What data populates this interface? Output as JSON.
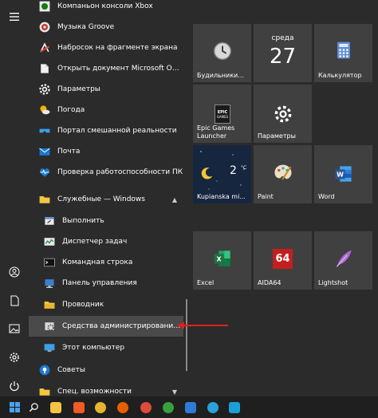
{
  "apps": [
    {
      "label": "Компаньон консоли Xbox",
      "icon": "xbox-icon"
    },
    {
      "label": "Музыка Groove",
      "icon": "groove-icon"
    },
    {
      "label": "Набросок на фрагменте экрана",
      "icon": "snip-icon"
    },
    {
      "label": "Открыть документ Microsoft Office",
      "icon": "office-icon"
    },
    {
      "label": "Параметры",
      "icon": "gear-icon"
    },
    {
      "label": "Погода",
      "icon": "weather-icon"
    },
    {
      "label": "Портал смешанной реальности",
      "icon": "mixed-reality-icon"
    },
    {
      "label": "Почта",
      "icon": "mail-icon"
    },
    {
      "label": "Проверка работоспособности ПК",
      "icon": "pc-health-icon"
    },
    {
      "label": "Служебные — Windows",
      "icon": "folder-icon"
    },
    {
      "label": "Выполнить",
      "icon": "run-icon"
    },
    {
      "label": "Диспетчер задач",
      "icon": "task-manager-icon"
    },
    {
      "label": "Командная строка",
      "icon": "cmd-icon"
    },
    {
      "label": "Панель управления",
      "icon": "control-panel-icon"
    },
    {
      "label": "Проводник",
      "icon": "explorer-icon"
    },
    {
      "label": "Средства администрирования Windows",
      "icon": "admin-tools-icon"
    },
    {
      "label": "Этот компьютер",
      "icon": "computer-icon"
    },
    {
      "label": "Советы",
      "icon": "tips-icon"
    },
    {
      "label": "Спец. возможности",
      "icon": "folder-icon"
    }
  ],
  "tiles": {
    "alarms": {
      "label": "Будильники..."
    },
    "calendar": {
      "day": "среда",
      "date": "27"
    },
    "calculator": {
      "label": "Калькулятор"
    },
    "epic": {
      "label": "Epic Games Launcher",
      "logo_top": "EPIC",
      "logo_bottom": "GAMES"
    },
    "settings": {
      "label": "Параметры"
    },
    "weather": {
      "temp": "2",
      "unit": "°C",
      "label": "Kupianska mi..."
    },
    "paint": {
      "label": "Paint"
    },
    "word": {
      "label": "Word"
    },
    "excel": {
      "label": "Excel"
    },
    "aida": {
      "label": "AIDA64",
      "badge": "64"
    },
    "lightshot": {
      "label": "Lightshot"
    }
  },
  "colors": {
    "accent_blue": "#0078d7",
    "excel_green": "#1e7145",
    "word_blue": "#2b579a",
    "aida_red": "#c41e1e",
    "annotation_red": "#e02020"
  }
}
